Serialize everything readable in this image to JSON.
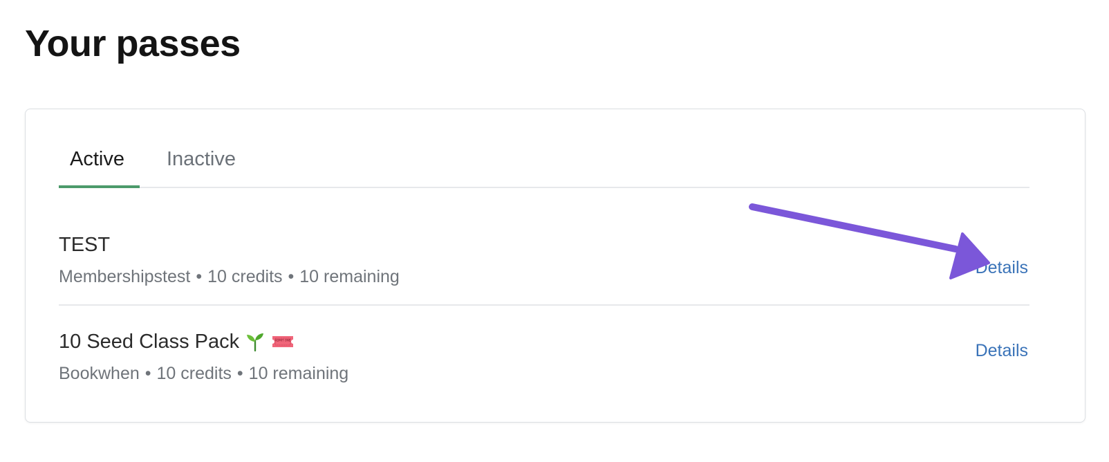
{
  "page": {
    "title": "Your passes"
  },
  "tabs": [
    {
      "label": "Active",
      "active": true
    },
    {
      "label": "Inactive",
      "active": false
    }
  ],
  "passes": [
    {
      "name": "TEST",
      "provider": "Membershipstest",
      "credits": "10 credits",
      "remaining": "10 remaining",
      "details_label": "Details",
      "icons": []
    },
    {
      "name": "10 Seed Class Pack",
      "provider": "Bookwhen",
      "credits": "10 credits",
      "remaining": "10 remaining",
      "details_label": "Details",
      "icons": [
        "seedling-icon",
        "admit-one-ticket-icon"
      ]
    }
  ],
  "ticket_icon_text": "ADMIT ONE",
  "separator": "•",
  "colors": {
    "active_tab_underline": "#4c9a6b",
    "link": "#3a73b8",
    "annotation_arrow": "#7b57d9"
  }
}
